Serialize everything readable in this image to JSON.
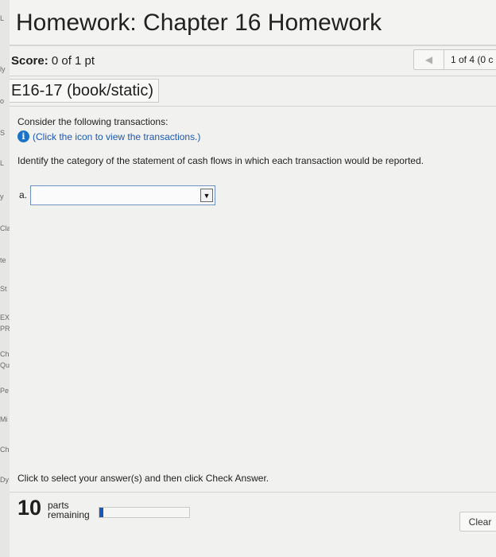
{
  "left_strip": {
    "fragments": [
      "L",
      "ly",
      "o",
      "S",
      "L",
      "y",
      "Cla",
      "te",
      "St",
      "EX",
      "PR",
      "Ch",
      "Qu",
      "Pe",
      "Mi",
      "Ch",
      "Dy"
    ]
  },
  "header": {
    "title": "Homework: Chapter 16 Homework"
  },
  "score": {
    "label": "Score:",
    "value": "0 of 1 pt"
  },
  "navigation": {
    "prev_icon": "left-triangle-icon",
    "position_text": "1 of 4 (0 c"
  },
  "question": {
    "id": "E16-17 (book/static)",
    "intro": "Consider the following transactions:",
    "info_link": "(Click the icon to view the transactions.)",
    "instruction": "Identify the category of the statement of cash flows in which each transaction would be reported.",
    "part_label": "a.",
    "answer_value": ""
  },
  "footer": {
    "instruction": "Click to select your answer(s) and then click Check Answer.",
    "parts_count": "10",
    "parts_label_line1": "parts",
    "parts_label_line2": "remaining",
    "progress_fraction": 0.04,
    "clear_label": "Clear"
  },
  "colors": {
    "accent": "#1c58b8",
    "info_icon": "#1a73c8"
  }
}
